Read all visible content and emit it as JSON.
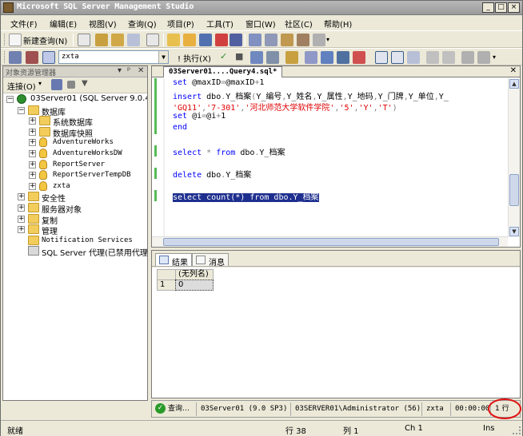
{
  "window": {
    "title": "Microsoft SQL Server Management Studio"
  },
  "menu": [
    "文件(F)",
    "编辑(E)",
    "视图(V)",
    "查询(Q)",
    "项目(P)",
    "工具(T)",
    "窗口(W)",
    "社区(C)",
    "帮助(H)"
  ],
  "toolbar1": {
    "new_query": "新建查询(N)"
  },
  "toolbar2": {
    "database": "zxta",
    "execute": "! 执行(X)"
  },
  "object_explorer": {
    "title": "对象资源管理器",
    "connect": "连接(O)",
    "tree": [
      {
        "label": "03Server01 (SQL Server 9.0.4",
        "level": 0,
        "icon": "server-icon",
        "expander": "−"
      },
      {
        "label": "数据库",
        "level": 1,
        "icon": "folder-icon",
        "expander": "−"
      },
      {
        "label": "系统数据库",
        "level": 2,
        "icon": "folder-icon",
        "expander": "+"
      },
      {
        "label": "数据库快照",
        "level": 2,
        "icon": "folder-icon",
        "expander": "+"
      },
      {
        "label": "AdventureWorks",
        "level": 2,
        "icon": "database-icon",
        "expander": "+",
        "mono": true
      },
      {
        "label": "AdventureWorksDW",
        "level": 2,
        "icon": "database-icon",
        "expander": "+",
        "mono": true
      },
      {
        "label": "ReportServer",
        "level": 2,
        "icon": "database-icon",
        "expander": "+",
        "mono": true
      },
      {
        "label": "ReportServerTempDB",
        "level": 2,
        "icon": "database-icon",
        "expander": "+",
        "mono": true
      },
      {
        "label": "zxta",
        "level": 2,
        "icon": "database-icon",
        "expander": "+",
        "mono": true
      },
      {
        "label": "安全性",
        "level": 1,
        "icon": "folder-icon",
        "expander": "+"
      },
      {
        "label": "服务器对象",
        "level": 1,
        "icon": "folder-icon",
        "expander": "+"
      },
      {
        "label": "复制",
        "level": 1,
        "icon": "folder-icon",
        "expander": "+"
      },
      {
        "label": "管理",
        "level": 1,
        "icon": "folder-icon",
        "expander": "+"
      },
      {
        "label": "Notification Services",
        "level": 1,
        "icon": "folder-icon",
        "expander": "",
        "mono": true
      },
      {
        "label": "SQL Server 代理(已禁用代理",
        "level": 1,
        "icon": "agent-icon",
        "expander": ""
      }
    ]
  },
  "editor": {
    "tab_title": "03Server01....Query4.sql*",
    "lines": [
      [
        {
          "t": "set ",
          "c": "kw"
        },
        {
          "t": "@maxID",
          "c": ""
        },
        {
          "t": "=",
          "c": "gray"
        },
        {
          "t": "@maxID",
          "c": ""
        },
        {
          "t": "+",
          "c": "gray"
        },
        {
          "t": "1",
          "c": ""
        }
      ],
      [
        {
          "t": "insert ",
          "c": "kw"
        },
        {
          "t": "dbo",
          "c": ""
        },
        {
          "t": ".",
          "c": "gray"
        },
        {
          "t": "Y_档案",
          "c": ""
        },
        {
          "t": "(",
          "c": "gray"
        },
        {
          "t": "Y_编号",
          "c": ""
        },
        {
          "t": ",",
          "c": "gray"
        },
        {
          "t": "Y_姓名",
          "c": ""
        },
        {
          "t": ",",
          "c": "gray"
        },
        {
          "t": "Y_属性",
          "c": ""
        },
        {
          "t": ",",
          "c": "gray"
        },
        {
          "t": "Y_地码",
          "c": ""
        },
        {
          "t": ",",
          "c": "gray"
        },
        {
          "t": "Y_门牌",
          "c": ""
        },
        {
          "t": ",",
          "c": "gray"
        },
        {
          "t": "Y_单位",
          "c": ""
        },
        {
          "t": ",",
          "c": "gray"
        },
        {
          "t": "Y_",
          "c": ""
        }
      ],
      [
        {
          "t": "'GQ11'",
          "c": "str"
        },
        {
          "t": ",",
          "c": "gray"
        },
        {
          "t": "'7-301'",
          "c": "str"
        },
        {
          "t": ",",
          "c": "gray"
        },
        {
          "t": "'河北师范大学软件学院'",
          "c": "str"
        },
        {
          "t": ",",
          "c": "gray"
        },
        {
          "t": "'5'",
          "c": "str"
        },
        {
          "t": ",",
          "c": "gray"
        },
        {
          "t": "'Y'",
          "c": "str"
        },
        {
          "t": ",",
          "c": "gray"
        },
        {
          "t": "'T'",
          "c": "str"
        },
        {
          "t": ")",
          "c": "gray"
        }
      ],
      [
        {
          "t": "set ",
          "c": "kw"
        },
        {
          "t": "@i",
          "c": ""
        },
        {
          "t": "=",
          "c": "gray"
        },
        {
          "t": "@i",
          "c": ""
        },
        {
          "t": "+",
          "c": "gray"
        },
        {
          "t": "1",
          "c": ""
        }
      ],
      [
        {
          "t": "end",
          "c": "kw"
        }
      ],
      [],
      [
        {
          "t": "select ",
          "c": "kw"
        },
        {
          "t": "* ",
          "c": "gray"
        },
        {
          "t": "from ",
          "c": "kw"
        },
        {
          "t": "dbo",
          "c": ""
        },
        {
          "t": ".",
          "c": "gray"
        },
        {
          "t": "Y_档案",
          "c": ""
        }
      ],
      [],
      [
        {
          "t": "delete ",
          "c": "kw"
        },
        {
          "t": "dbo",
          "c": ""
        },
        {
          "t": ".",
          "c": "gray"
        },
        {
          "t": "Y_档案",
          "c": ""
        }
      ],
      [],
      [
        {
          "t": "select count(*) from dbo.Y_档案",
          "c": "sel"
        }
      ]
    ]
  },
  "results": {
    "tabs": [
      "结果",
      "消息"
    ],
    "column_header": "(无列名)",
    "row_number": "1",
    "value": "0"
  },
  "query_status": {
    "state": "查询…",
    "server": "03Server01 (9.0 SP3)",
    "user": "03SERVER01\\Administrator (56)",
    "database": "zxta",
    "elapsed": "00:00:00",
    "rows": "1 行"
  },
  "statusbar": {
    "ready": "就绪",
    "line": "行 38",
    "col": "列 1",
    "ch": "Ch 1",
    "ins": "Ins"
  }
}
